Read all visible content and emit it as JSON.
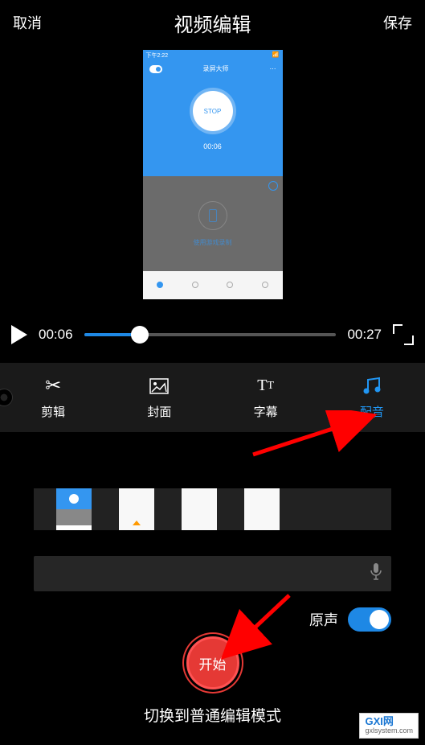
{
  "header": {
    "cancel": "取消",
    "title": "视频编辑",
    "save": "保存"
  },
  "preview": {
    "statusTime": "下午2:22",
    "appTitle": "录屏大师",
    "stopLabel": "STOP",
    "recTime": "00:06",
    "bottomLabel": "使用游戏录制"
  },
  "player": {
    "current": "00:06",
    "total": "00:27"
  },
  "tools": [
    {
      "label": "剪辑"
    },
    {
      "label": "封面"
    },
    {
      "label": "字幕"
    },
    {
      "label": "配音"
    }
  ],
  "voice": {
    "label": "原声"
  },
  "start": "开始",
  "modeText": "切换到普通编辑模式",
  "watermark": {
    "main": "GXI网",
    "sub": "gxlsystem.com"
  }
}
